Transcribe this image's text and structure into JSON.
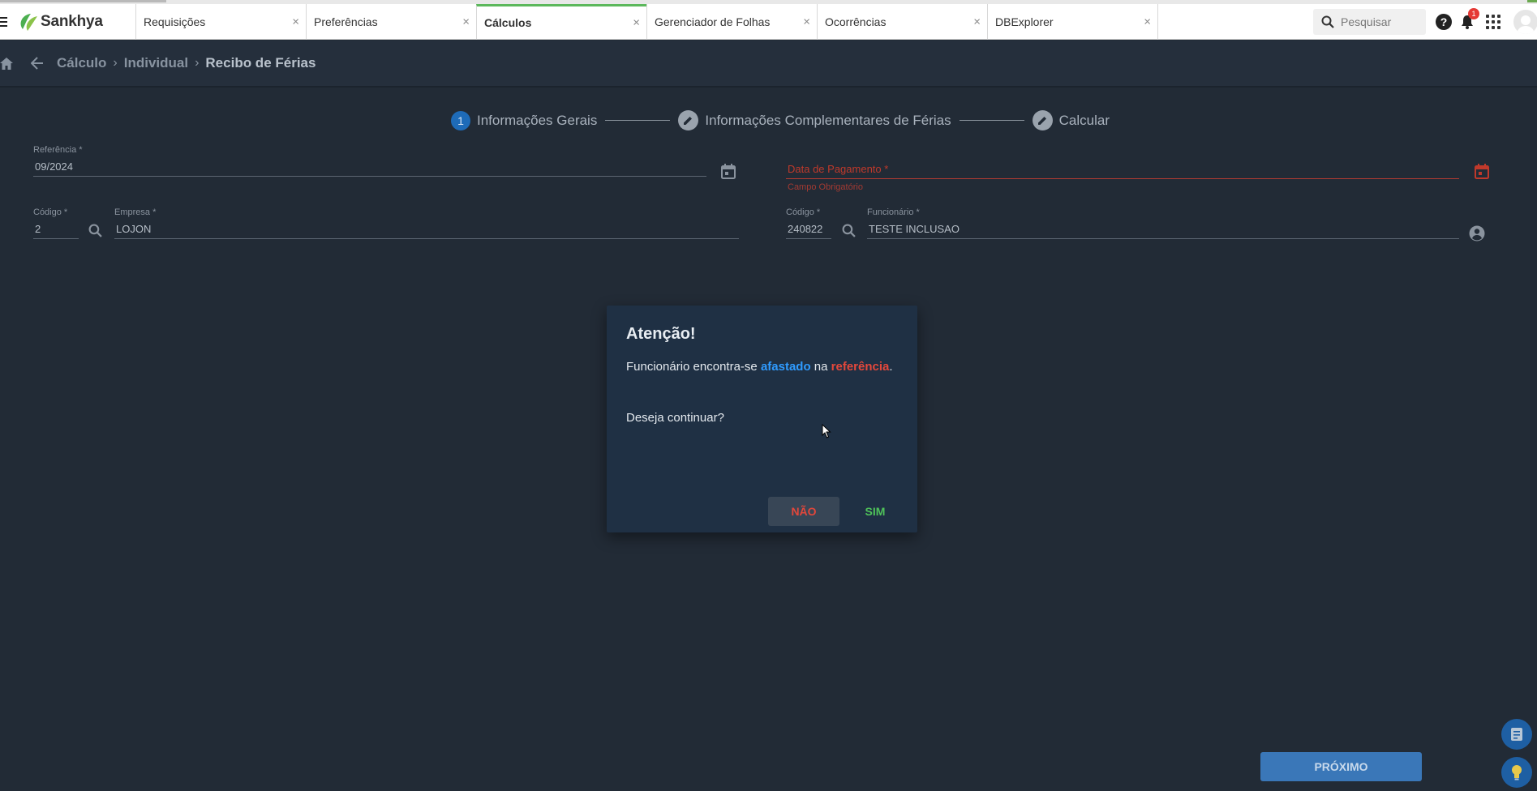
{
  "app": {
    "brand": "Sankhya"
  },
  "tabs": [
    {
      "label": "Requisições",
      "close": "×",
      "active": false
    },
    {
      "label": "Preferências",
      "close": "×",
      "active": false
    },
    {
      "label": "Cálculos",
      "close": "×",
      "active": true
    },
    {
      "label": "Gerenciador de Folhas",
      "close": "×",
      "active": false
    },
    {
      "label": "Ocorrências",
      "close": "×",
      "active": false
    },
    {
      "label": "DBExplorer",
      "close": "×",
      "active": false
    }
  ],
  "topbar": {
    "search_placeholder": "Pesquisar",
    "help_label": "?",
    "notification_count": "1"
  },
  "breadcrumb": {
    "items": [
      "Cálculo",
      "Individual",
      "Recibo de Férias"
    ],
    "separator": "›"
  },
  "stepper": {
    "step1_number": "1",
    "step1_label": "Informações Gerais",
    "step2_label": "Informações Complementares de Férias",
    "step3_label": "Calcular"
  },
  "form": {
    "referencia": {
      "label": "Referência *",
      "value": "09/2024"
    },
    "data_pagamento": {
      "label": "Data de Pagamento *",
      "error": "Campo Obrigatório"
    },
    "empresa_codigo": {
      "label": "Código *",
      "value": "2"
    },
    "empresa": {
      "label": "Empresa *",
      "value": "LOJON"
    },
    "funcionario_codigo": {
      "label": "Código *",
      "value": "240822"
    },
    "funcionario": {
      "label": "Funcionário *",
      "value": "TESTE INCLUSAO"
    }
  },
  "dialog": {
    "title": "Atenção!",
    "msg_part1": "Funcionário encontra-se ",
    "msg_highlight1": "afastado",
    "msg_part2": " na ",
    "msg_highlight2": "referência",
    "msg_part3": ".",
    "question": "Deseja continuar?",
    "no_label": "NÃO",
    "yes_label": "SIM"
  },
  "footer": {
    "next_label": "PRÓXIMO"
  },
  "colors": {
    "background": "#222b36",
    "dialog_bg": "#1f3044",
    "accent_blue": "#2f9bff",
    "error_red": "#e5483b",
    "success_green": "#4fc35a",
    "active_tab": "#5cb85c"
  },
  "icons": [
    "menu-icon",
    "sankhya-logo-icon",
    "close-icon",
    "search-icon",
    "help-icon",
    "bell-icon",
    "apps-icon",
    "user-avatar-icon",
    "home-icon",
    "back-arrow-icon",
    "chevron-right-icon",
    "edit-icon",
    "calendar-icon",
    "account-circle-icon"
  ]
}
